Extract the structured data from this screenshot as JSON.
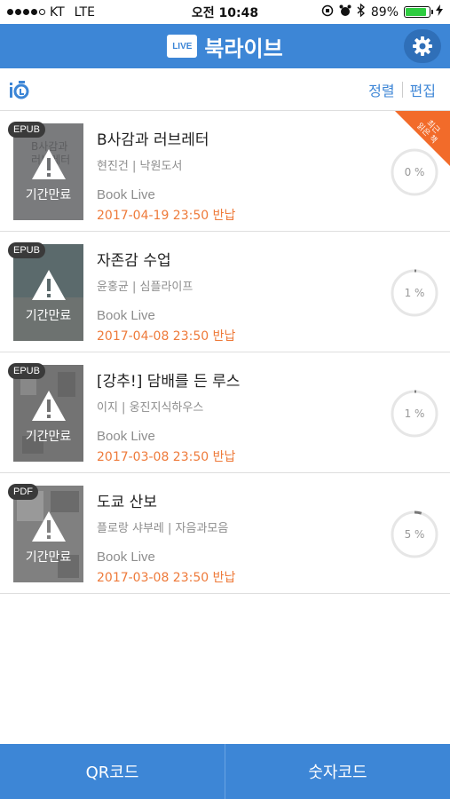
{
  "status_bar": {
    "carrier": "KT",
    "network": "LTE",
    "time": "오전 10:48",
    "battery": "89%"
  },
  "header": {
    "logo_text": "LIVE",
    "title": "북라이브"
  },
  "toolbar": {
    "sort_label": "정렬",
    "edit_label": "편집"
  },
  "books": [
    {
      "format": "EPUB",
      "title": "B사감과 러브레터",
      "meta": "현진건 | 낙원도서",
      "publisher": "Book Live",
      "due": "2017-04-19 23:50 반납",
      "cover_label": "기간만료",
      "progress_text": "0 %",
      "progress": 0,
      "ribbon_text": "최근\n읽은 책"
    },
    {
      "format": "EPUB",
      "title": "자존감 수업",
      "meta": "윤홍균 | 심플라이프",
      "publisher": "Book Live",
      "due": "2017-04-08 23:50 반납",
      "cover_label": "기간만료",
      "progress_text": "1 %",
      "progress": 1
    },
    {
      "format": "EPUB",
      "title": "[강추!] 담배를 든 루스",
      "meta": "이지 | 웅진지식하우스",
      "publisher": "Book Live",
      "due": "2017-03-08 23:50 반납",
      "cover_label": "기간만료",
      "progress_text": "1 %",
      "progress": 1
    },
    {
      "format": "PDF",
      "title": "도쿄 산보",
      "meta": "플로랑 샤부레 | 자음과모음",
      "publisher": "Book Live",
      "due": "2017-03-08 23:50 반납",
      "cover_label": "기간만료",
      "progress_text": "5 %",
      "progress": 5
    }
  ],
  "bottom_bar": {
    "qr_label": "QR코드",
    "number_label": "숫자코드"
  },
  "colors": {
    "brand_blue": "#3d86d6",
    "due_orange": "#ee7a3a",
    "ribbon_orange": "#f26b2a"
  }
}
